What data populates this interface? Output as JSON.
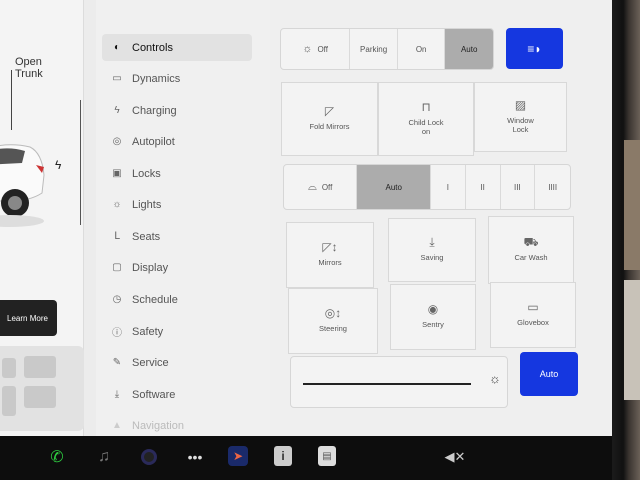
{
  "car": {
    "trunk_line1": "Open",
    "trunk_line2": "Trunk",
    "learn_more": "Learn More"
  },
  "nav": {
    "items": [
      {
        "label": "Controls",
        "icon": "toggle-icon",
        "glyph": "◐"
      },
      {
        "label": "Dynamics",
        "icon": "car-icon",
        "glyph": "▭"
      },
      {
        "label": "Charging",
        "icon": "bolt-icon",
        "glyph": "ϟ"
      },
      {
        "label": "Autopilot",
        "icon": "steering-wheel-icon",
        "glyph": "◎"
      },
      {
        "label": "Locks",
        "icon": "lock-icon",
        "glyph": "▣"
      },
      {
        "label": "Lights",
        "icon": "sun-icon",
        "glyph": "☼"
      },
      {
        "label": "Seats",
        "icon": "seat-icon",
        "glyph": "ᒪ"
      },
      {
        "label": "Display",
        "icon": "display-icon",
        "glyph": "▢"
      },
      {
        "label": "Schedule",
        "icon": "clock-icon",
        "glyph": "◷"
      },
      {
        "label": "Safety",
        "icon": "info-icon",
        "glyph": "ⓘ"
      },
      {
        "label": "Service",
        "icon": "wrench-icon",
        "glyph": "✎"
      },
      {
        "label": "Software",
        "icon": "download-icon",
        "glyph": "⤓"
      },
      {
        "label": "Navigation",
        "icon": "navigation-icon",
        "glyph": "▲"
      }
    ]
  },
  "lights": {
    "options": [
      "Off",
      "Parking",
      "On",
      "Auto"
    ],
    "selected": "Auto",
    "headlight_button_icon": "headlight-icon"
  },
  "quick_tiles_top": [
    {
      "label": "Fold Mirrors",
      "icon": "mirror-icon",
      "glyph": "◸"
    },
    {
      "label": "Child Lock",
      "sub": "on",
      "icon": "child-lock-icon",
      "glyph": "⊓"
    },
    {
      "label": "Window",
      "sub": "Lock",
      "icon": "window-icon",
      "glyph": "▨"
    }
  ],
  "wipers": {
    "off_label": "Off",
    "auto_label": "Auto",
    "speeds": [
      "I",
      "II",
      "III",
      "IIII"
    ],
    "selected": "Auto"
  },
  "quick_tiles_grid": [
    {
      "label": "Mirrors",
      "icon": "mirror-adjust-icon",
      "glyph": "◸↕"
    },
    {
      "label": "Saving",
      "icon": "download-icon",
      "glyph": "⤓"
    },
    {
      "label": "Car Wash",
      "icon": "car-wash-icon",
      "glyph": "⛟"
    },
    {
      "label": "Steering",
      "icon": "steering-adjust-icon",
      "glyph": "◎↕"
    },
    {
      "label": "Sentry",
      "icon": "sentry-icon",
      "glyph": "◉"
    },
    {
      "label": "Glovebox",
      "icon": "glovebox-icon",
      "glyph": "▭"
    }
  ],
  "brightness": {
    "auto_label": "Auto",
    "icon": "brightness-icon"
  },
  "taskbar": {
    "info_glyph": "i"
  },
  "colors": {
    "accent": "#1537e0",
    "selected_segment": "#acacac"
  }
}
